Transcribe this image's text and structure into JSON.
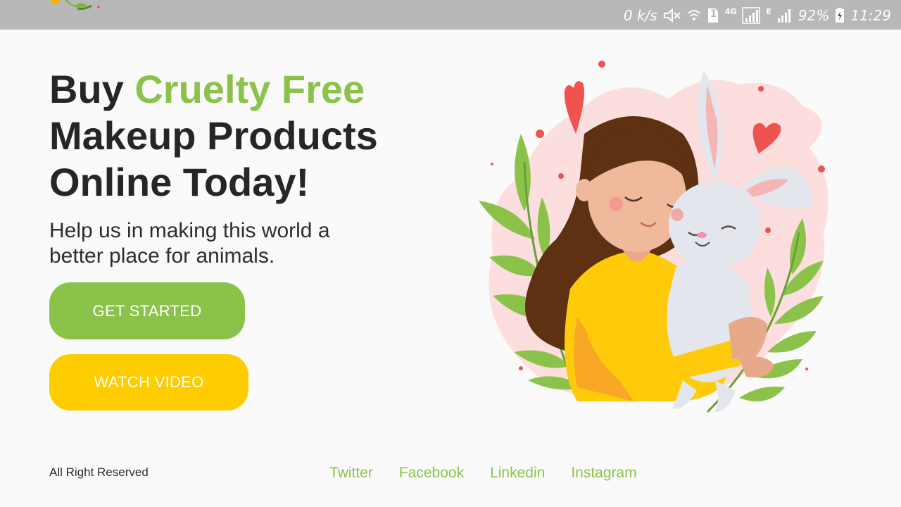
{
  "status_bar": {
    "speed": "0 k/s",
    "sim_badge": "1",
    "network_type": "4G",
    "network_type_2": "E",
    "battery": "92%",
    "time": "11:29",
    "icons": [
      "mute-icon",
      "wifi-icon",
      "sim-icon",
      "signal-icon",
      "signal-icon",
      "battery-charging-icon"
    ]
  },
  "hero": {
    "headline_prefix": "Buy ",
    "headline_accent": "Cruelty Free",
    "headline_line2": "Makeup Products",
    "headline_line3": "Online Today!",
    "subtitle": "Help us in making this world a better place for animals.",
    "primary_button": "GET STARTED",
    "secondary_button": "WATCH VIDEO"
  },
  "footer": {
    "copyright": "All Right Reserved",
    "links": [
      "Twitter",
      "Facebook",
      "Linkedin",
      "Instagram"
    ]
  },
  "colors": {
    "accent_green": "#8bc34a",
    "accent_yellow": "#ffcc00",
    "status_bar": "#b8b8b8",
    "text_dark": "#262626",
    "heart_red": "#ef5350",
    "blob_pink": "#fddede"
  }
}
